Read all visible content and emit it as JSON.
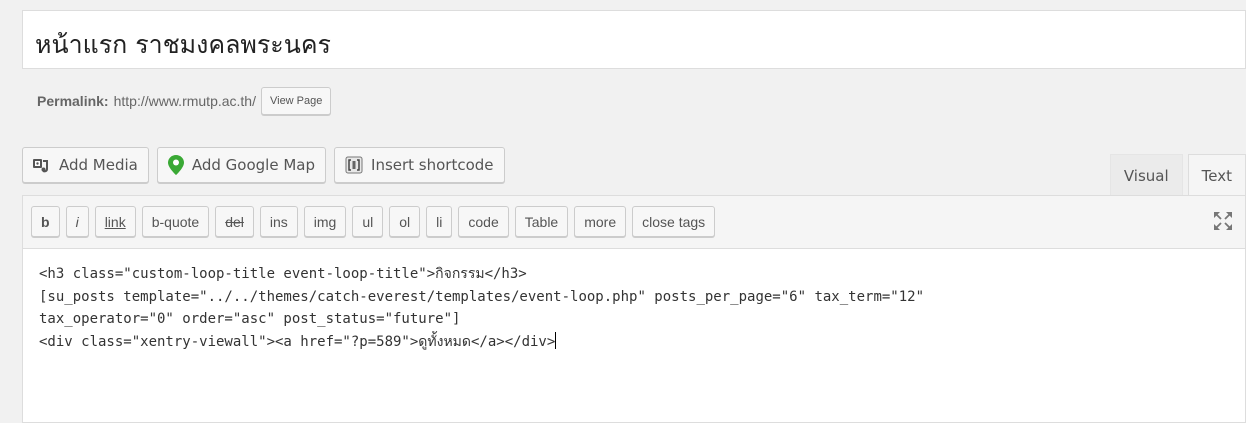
{
  "post": {
    "title": "หน้าแรก ราชมงคลพระนคร"
  },
  "permalink": {
    "label": "Permalink:",
    "url": "http://www.rmutp.ac.th/",
    "view_button": "View Page"
  },
  "media_buttons": [
    {
      "label": "Add Media",
      "icon": "media-icon"
    },
    {
      "label": "Add Google Map",
      "icon": "map-pin-icon"
    },
    {
      "label": "Insert shortcode",
      "icon": "shortcode-icon"
    }
  ],
  "editor_tabs": {
    "visual": "Visual",
    "text": "Text",
    "active": "Text"
  },
  "quicktags": [
    "b",
    "i",
    "link",
    "b-quote",
    "del",
    "ins",
    "img",
    "ul",
    "ol",
    "li",
    "code",
    "Table",
    "more",
    "close tags"
  ],
  "content_lines": [
    "<h3 class=\"custom-loop-title event-loop-title\">กิจกรรม</h3>",
    "[su_posts template=\"../../themes/catch-everest/templates/event-loop.php\" posts_per_page=\"6\" tax_term=\"12\"",
    "tax_operator=\"0\" order=\"asc\" post_status=\"future\"]",
    "<div class=\"xentry-viewall\"><a href=\"?p=589\">ดูทั้งหมด</a></div>"
  ],
  "colors": {
    "map_pin": "#3aa935",
    "background": "#f1f1f1",
    "border": "#dddddd"
  }
}
